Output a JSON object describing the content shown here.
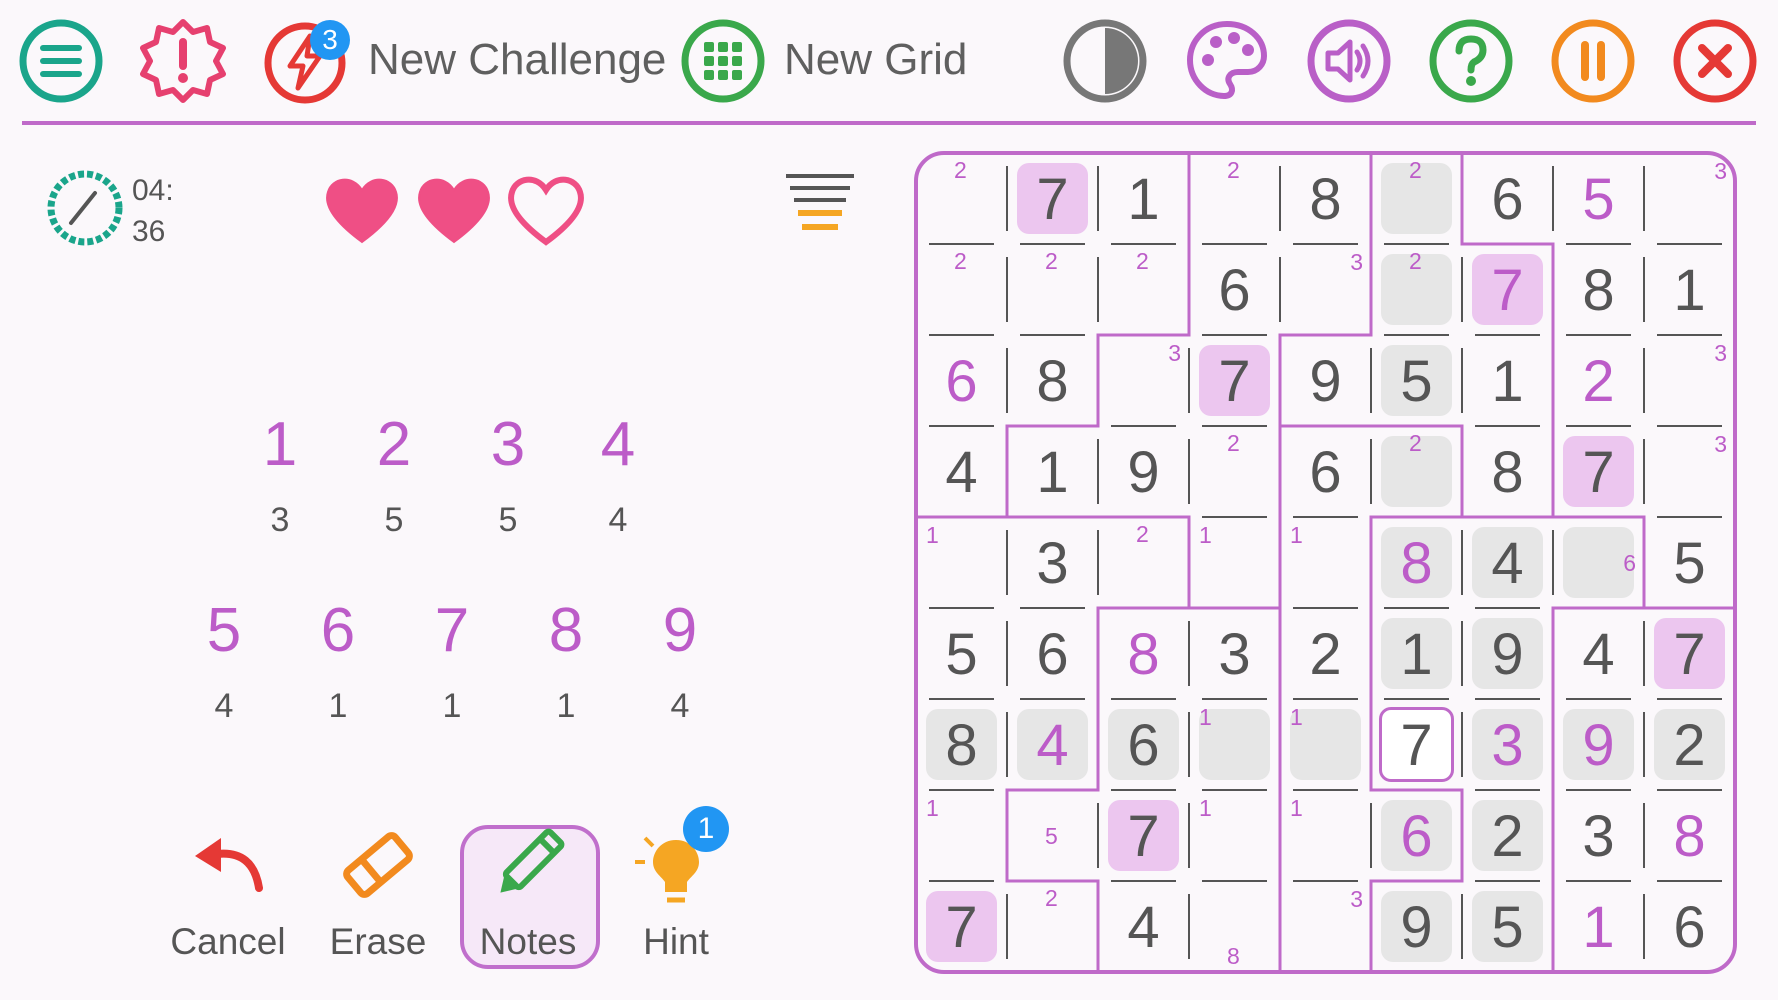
{
  "toolbar": {
    "challenge_badge": "3",
    "new_challenge_label": "New Challenge",
    "new_grid_label": "New Grid",
    "icons": [
      "menu-icon",
      "alert-icon",
      "lightning-icon",
      "grid-icon",
      "contrast-icon",
      "palette-icon",
      "sound-icon",
      "help-icon",
      "pause-icon",
      "close-icon"
    ]
  },
  "status": {
    "timer_minutes": "04:",
    "timer_seconds": "36",
    "lives_total": 3,
    "lives_remaining": 2
  },
  "numpad": [
    {
      "digit": "1",
      "remaining": "3"
    },
    {
      "digit": "2",
      "remaining": "5"
    },
    {
      "digit": "3",
      "remaining": "5"
    },
    {
      "digit": "4",
      "remaining": "4"
    },
    {
      "digit": "5",
      "remaining": "4"
    },
    {
      "digit": "6",
      "remaining": "1"
    },
    {
      "digit": "7",
      "remaining": "1"
    },
    {
      "digit": "8",
      "remaining": "1"
    },
    {
      "digit": "9",
      "remaining": "4"
    }
  ],
  "actions": {
    "cancel": "Cancel",
    "erase": "Erase",
    "notes": "Notes",
    "hint": "Hint",
    "hint_badge": "1"
  },
  "colors": {
    "accent": "#bf6ac9",
    "digit_purple": "#bc5cc8",
    "given_gray": "#555555",
    "highlight_purple": "#ecc6ef",
    "highlight_gray": "#e6e6e6",
    "heart": "#ef4f85"
  },
  "board": {
    "selected": [
      6,
      5
    ],
    "regions": [
      [
        0,
        0,
        0,
        1,
        1,
        2,
        3,
        3,
        3
      ],
      [
        0,
        0,
        0,
        1,
        1,
        2,
        2,
        3,
        3
      ],
      [
        0,
        0,
        1,
        1,
        2,
        2,
        2,
        3,
        3
      ],
      [
        0,
        1,
        1,
        1,
        4,
        4,
        2,
        3,
        3
      ],
      [
        5,
        5,
        5,
        1,
        4,
        6,
        6,
        6,
        3
      ],
      [
        5,
        5,
        7,
        7,
        4,
        6,
        6,
        8,
        8
      ],
      [
        5,
        5,
        7,
        7,
        4,
        6,
        6,
        8,
        8
      ],
      [
        5,
        7,
        7,
        7,
        4,
        4,
        6,
        8,
        8
      ],
      [
        5,
        5,
        7,
        7,
        4,
        6,
        6,
        8,
        8
      ]
    ],
    "cells": [
      [
        {
          "n": [
            2
          ]
        },
        {
          "v": "7",
          "c": "g",
          "h": "p"
        },
        {
          "v": "1",
          "c": "g"
        },
        {
          "n": [
            2
          ]
        },
        {
          "v": "8",
          "c": "g"
        },
        {
          "n": [
            2
          ],
          "h": "g"
        },
        {
          "v": "6",
          "c": "g"
        },
        {
          "v": "5",
          "c": "p"
        },
        {
          "n": [
            3
          ]
        }
      ],
      [
        {
          "n": [
            2
          ]
        },
        {
          "n": [
            2
          ]
        },
        {
          "n": [
            2
          ]
        },
        {
          "v": "6",
          "c": "g"
        },
        {
          "n": [
            3
          ]
        },
        {
          "n": [
            2
          ],
          "h": "g"
        },
        {
          "v": "7",
          "c": "p",
          "h": "p"
        },
        {
          "v": "8",
          "c": "g"
        },
        {
          "v": "1",
          "c": "g"
        }
      ],
      [
        {
          "v": "6",
          "c": "p"
        },
        {
          "v": "8",
          "c": "g"
        },
        {
          "n": [
            3
          ]
        },
        {
          "v": "7",
          "c": "g",
          "h": "p"
        },
        {
          "v": "9",
          "c": "g"
        },
        {
          "v": "5",
          "c": "g",
          "h": "g"
        },
        {
          "v": "1",
          "c": "g"
        },
        {
          "v": "2",
          "c": "p"
        },
        {
          "n": [
            3
          ]
        }
      ],
      [
        {
          "v": "4",
          "c": "g"
        },
        {
          "v": "1",
          "c": "g"
        },
        {
          "v": "9",
          "c": "g"
        },
        {
          "n": [
            2
          ]
        },
        {
          "v": "6",
          "c": "g"
        },
        {
          "n": [
            2
          ],
          "h": "g"
        },
        {
          "v": "8",
          "c": "g"
        },
        {
          "v": "7",
          "c": "g",
          "h": "p"
        },
        {
          "n": [
            3
          ]
        }
      ],
      [
        {
          "n": [
            1
          ]
        },
        {
          "v": "3",
          "c": "g"
        },
        {
          "n": [
            2
          ]
        },
        {
          "n": [
            1
          ]
        },
        {
          "n": [
            1
          ]
        },
        {
          "v": "8",
          "c": "p",
          "h": "g"
        },
        {
          "v": "4",
          "c": "g",
          "h": "g"
        },
        {
          "n": [
            6
          ],
          "h": "g"
        },
        {
          "v": "5",
          "c": "g"
        }
      ],
      [
        {
          "v": "5",
          "c": "g"
        },
        {
          "v": "6",
          "c": "g"
        },
        {
          "v": "8",
          "c": "p"
        },
        {
          "v": "3",
          "c": "g"
        },
        {
          "v": "2",
          "c": "g"
        },
        {
          "v": "1",
          "c": "g",
          "h": "g"
        },
        {
          "v": "9",
          "c": "g",
          "h": "g"
        },
        {
          "v": "4",
          "c": "g"
        },
        {
          "v": "7",
          "c": "g",
          "h": "p"
        }
      ],
      [
        {
          "v": "8",
          "c": "g",
          "h": "g"
        },
        {
          "v": "4",
          "c": "p",
          "h": "g"
        },
        {
          "v": "6",
          "c": "g",
          "h": "g"
        },
        {
          "n": [
            1
          ],
          "h": "g"
        },
        {
          "n": [
            1
          ],
          "h": "g"
        },
        {
          "v": "7",
          "c": "g",
          "sel": true
        },
        {
          "v": "3",
          "c": "p",
          "h": "g"
        },
        {
          "v": "9",
          "c": "p",
          "h": "g"
        },
        {
          "v": "2",
          "c": "g",
          "h": "g"
        }
      ],
      [
        {
          "n": [
            1
          ]
        },
        {
          "n": [
            5
          ]
        },
        {
          "v": "7",
          "c": "g",
          "h": "p"
        },
        {
          "n": [
            1
          ]
        },
        {
          "n": [
            1
          ]
        },
        {
          "v": "6",
          "c": "p",
          "h": "g"
        },
        {
          "v": "2",
          "c": "g",
          "h": "g"
        },
        {
          "v": "3",
          "c": "g"
        },
        {
          "v": "8",
          "c": "p"
        }
      ],
      [
        {
          "v": "7",
          "c": "g",
          "h": "p"
        },
        {
          "n": [
            2
          ]
        },
        {
          "v": "4",
          "c": "g"
        },
        {
          "n": [
            8
          ]
        },
        {
          "n": [
            3
          ]
        },
        {
          "v": "9",
          "c": "g",
          "h": "g"
        },
        {
          "v": "5",
          "c": "g",
          "h": "g"
        },
        {
          "v": "1",
          "c": "p"
        },
        {
          "v": "6",
          "c": "g"
        }
      ]
    ]
  }
}
